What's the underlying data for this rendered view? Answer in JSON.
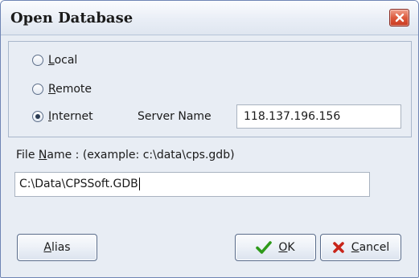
{
  "window": {
    "title": "Open Database"
  },
  "connection": {
    "options": [
      {
        "label": "Local",
        "mnemonic": "L",
        "rest": "ocal",
        "selected": false
      },
      {
        "label": "Remote",
        "mnemonic": "R",
        "rest": "emote",
        "selected": false
      },
      {
        "label": "Internet",
        "mnemonic": "I",
        "rest": "nternet",
        "selected": true
      }
    ],
    "server_name_label": "Server Name",
    "server_name_value": "118.137.196.156"
  },
  "file": {
    "label_prefix": "File ",
    "label_mnemonic": "N",
    "label_rest": "ame :  (example: c:\\data\\cps.gdb)",
    "value": "C:\\Data\\CPSSoft.GDB"
  },
  "buttons": {
    "alias": {
      "mnemonic": "A",
      "rest": "lias"
    },
    "ok": {
      "mnemonic": "O",
      "rest": "K"
    },
    "cancel": {
      "mnemonic": "C",
      "rest": "ancel"
    }
  },
  "icons": {
    "ok": "checkmark-icon",
    "cancel": "x-icon",
    "close": "close-icon"
  },
  "colors": {
    "ok_icon": "#2e9a1a",
    "cancel_icon": "#c8251a",
    "close_button": "#d4492e"
  }
}
